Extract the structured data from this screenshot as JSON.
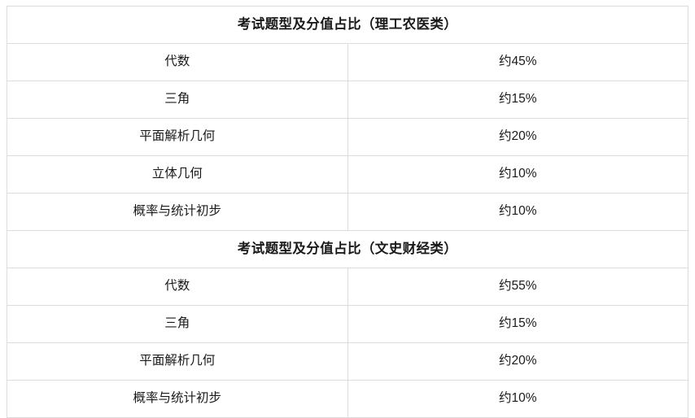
{
  "document": {
    "tables": [
      {
        "title": "考试题型及分值占比（理工农医类）",
        "rows": [
          {
            "topic": "代数",
            "value": "约45%"
          },
          {
            "topic": "三角",
            "value": "约15%"
          },
          {
            "topic": "平面解析几何",
            "value": "约20%"
          },
          {
            "topic": "立体几何",
            "value": "约10%"
          },
          {
            "topic": "概率与统计初步",
            "value": "约10%"
          }
        ]
      },
      {
        "title": "考试题型及分值占比（文史财经类）",
        "rows": [
          {
            "topic": "代数",
            "value": "约55%"
          },
          {
            "topic": "三角",
            "value": "约15%"
          },
          {
            "topic": "平面解析几何",
            "value": "约20%"
          },
          {
            "topic": "概率与统计初步",
            "value": "约10%"
          }
        ]
      }
    ]
  },
  "style": {
    "border_color": "#dcdcdc",
    "text_color": "#1a1a1a",
    "background_color": "#ffffff"
  }
}
